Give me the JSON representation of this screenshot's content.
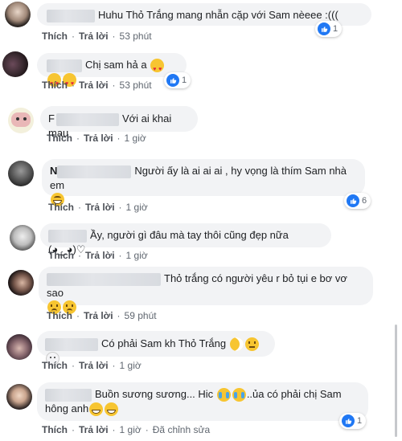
{
  "actions": {
    "like": "Thích",
    "reply": "Trả lời",
    "edited": "Đã chỉnh sửa"
  },
  "comments": [
    {
      "text": "Huhu Thỏ Trắng mang nhẫn cặp với Sam nèeee :(((",
      "time": "53 phút",
      "likes": "1"
    },
    {
      "text": "Chị sam hả a",
      "time": "53 phút",
      "likes": "1"
    },
    {
      "name_visible": "F",
      "text": "Với ai khai mau",
      "time": "1 giờ"
    },
    {
      "name_visible": "N",
      "text": "Người ấy là ai ai ai , hy vọng là thím Sam nhà em",
      "time": "1 giờ",
      "likes": "6"
    },
    {
      "text": "Ầy, người gì đâu mà tay thôi cũng đẹp nữa (◕‿◕)♡",
      "time": "1 giờ"
    },
    {
      "text": "Thỏ trắng có người yêu r bỏ tụi e bơ vơ sao",
      "time": "59 phút"
    },
    {
      "text": "Có phải Sam kh Thỏ Trắng",
      "time": "1 giờ"
    },
    {
      "text_line1": "Buồn sương sương... Hic",
      "text_line1b": "..ủa có phải chị Sam",
      "text_line2": "hông anh",
      "time": "1 giờ",
      "likes": "1"
    }
  ],
  "icons": {
    "like": "like-thumb-icon",
    "grin_emoji": "grinning-emoji-icon",
    "heart_eyes": "heart-eyes-emoji-icon",
    "sad_emoji": "sad-emoji-icon",
    "crying": "crying-emoji-icon",
    "moon": "moon-emoji-icon",
    "neutral": "neutral-emoji-icon",
    "ghost": "ghost-emoji-icon"
  },
  "colors": {
    "like_blue": "#2078f4",
    "bubble": "#f2f3f5",
    "action_text": "#4b4f56"
  }
}
